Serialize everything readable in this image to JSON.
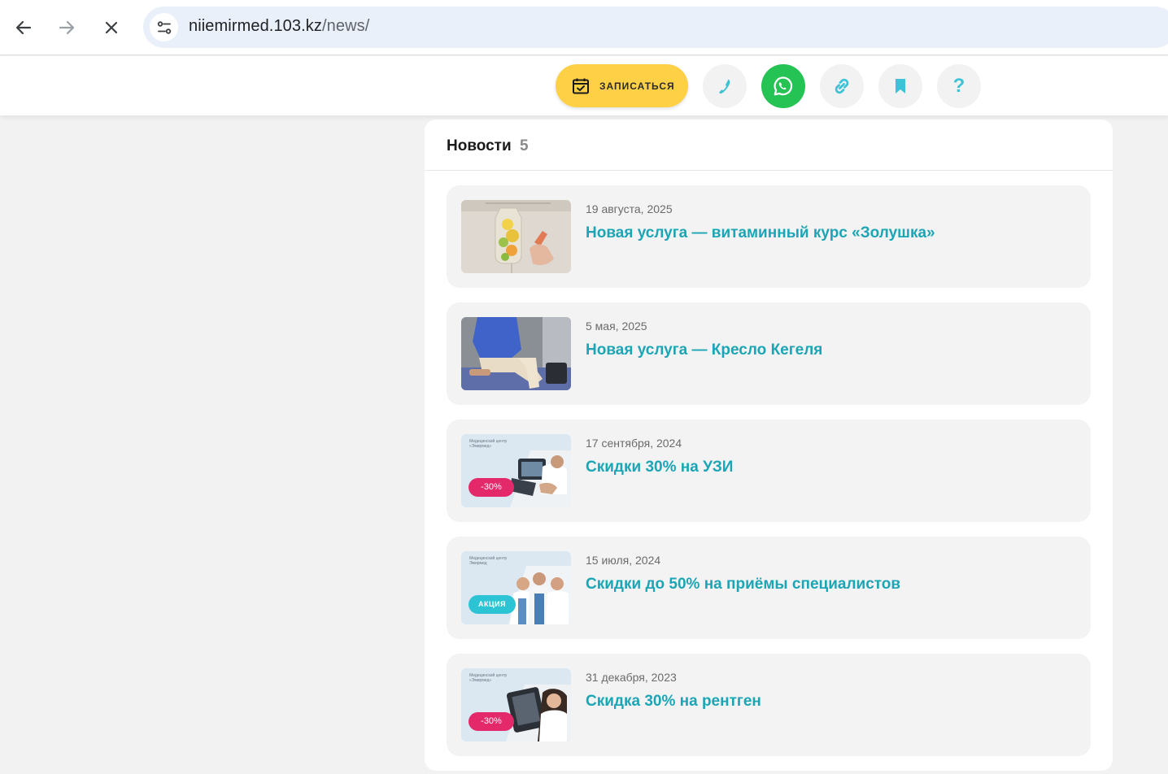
{
  "browser": {
    "url_host": "niiemirmed.103.kz",
    "url_path": "/news/",
    "icons": [
      "arrow-left-icon",
      "arrow-right-icon",
      "close-icon",
      "site-info-icon"
    ]
  },
  "toolbar": {
    "book_label": "ЗАПИСАТЬСЯ",
    "help_label": "?",
    "accent_yellow": "#fdd046",
    "accent_green": "#25c254",
    "accent_teal": "#3cc3d6"
  },
  "news": {
    "title": "Новости",
    "count": "5",
    "items": [
      {
        "date": "19 августа, 2025",
        "title": "Новая услуга — витаминный курс «Золушка»",
        "thumb": "iv-drip-photo"
      },
      {
        "date": "5 мая, 2025",
        "title": "Новая услуга — Кресло Кегеля",
        "thumb": "kegel-chair-photo"
      },
      {
        "date": "17 сентября, 2024",
        "title": "Скидки 30% на УЗИ",
        "thumb": "ultrasound-promo",
        "promo_caption": "Медицинский центр «Эмирмед»",
        "badge": "-30%"
      },
      {
        "date": "15 июля, 2024",
        "title": "Скидки до 50% на приёмы специалистов",
        "thumb": "doctors-promo",
        "promo_caption": "Медицинский центр Эмирмед",
        "badge": "АКЦИЯ"
      },
      {
        "date": "31 декабря, 2023",
        "title": "Скидка 30% на рентген",
        "thumb": "xray-promo",
        "promo_caption": "Медицинский центр «Эмирмед»",
        "badge": "-30%"
      }
    ]
  }
}
